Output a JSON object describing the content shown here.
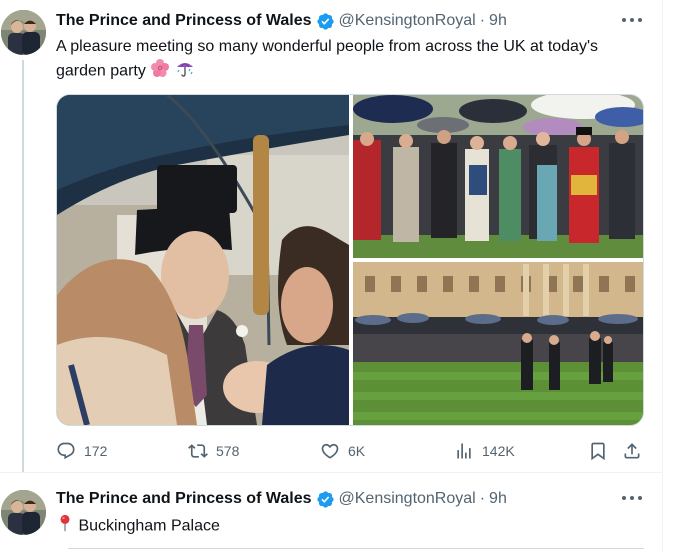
{
  "tweets": [
    {
      "author_name": "The Prince and Princess of Wales",
      "handle": "@KensingtonRoyal",
      "separator": "·",
      "time": "9h",
      "text": "A pleasure meeting so many wonderful people from across the UK at today's garden party",
      "emojis": [
        "hibiscus-emoji",
        "umbrella-rain-emoji"
      ],
      "stats": {
        "replies": "172",
        "retweets": "578",
        "likes": "6K",
        "views": "142K"
      }
    },
    {
      "author_name": "The Prince and Princess of Wales",
      "handle": "@KensingtonRoyal",
      "separator": "·",
      "time": "9h",
      "text": "Buckingham Palace",
      "emojis": [
        "round-pushpin-emoji"
      ]
    }
  ],
  "colors": {
    "verified_blue": "#1d9bf0",
    "muted_text": "#536471",
    "divider": "#eff3f4",
    "thread_line": "#cfd9de"
  },
  "icons": [
    "verified-badge-icon",
    "more-icon",
    "reply-icon",
    "retweet-icon",
    "like-icon",
    "views-icon",
    "bookmark-icon",
    "share-icon"
  ]
}
